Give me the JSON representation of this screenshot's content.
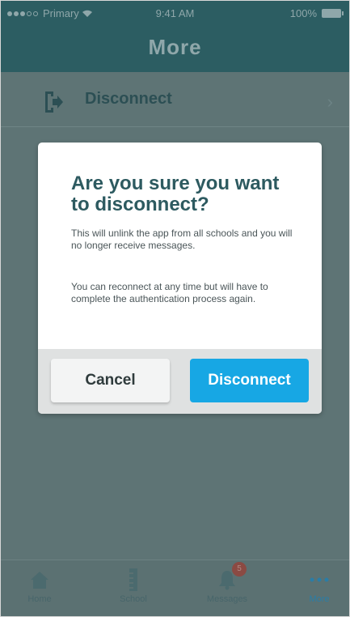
{
  "status_bar": {
    "carrier": "Primary",
    "time": "9:41 AM",
    "battery": "100%"
  },
  "nav": {
    "title": "More"
  },
  "list": {
    "items": [
      {
        "label": "Disconnect",
        "icon": "sign-out-icon"
      }
    ]
  },
  "dialog": {
    "title": "Are you sure you want to disconnect?",
    "paragraph_1": "This will unlink the app from all schools and you will no longer receive messages.",
    "paragraph_2": "You can reconnect at any time but will have to complete the authentication process again.",
    "cancel_label": "Cancel",
    "confirm_label": "Disconnect"
  },
  "tabbar": {
    "tabs": [
      {
        "label": "Home",
        "icon": "home-icon"
      },
      {
        "label": "School",
        "icon": "ruler-icon"
      },
      {
        "label": "Messages",
        "icon": "bell-icon",
        "badge": "5"
      },
      {
        "label": "More",
        "icon": "more-dots-icon",
        "active": true
      }
    ]
  },
  "colors": {
    "nav_bg": "#2c5d62",
    "overlay_bg": "#5e7475",
    "accent": "#17a7e4",
    "title_text": "#2d5a60"
  }
}
